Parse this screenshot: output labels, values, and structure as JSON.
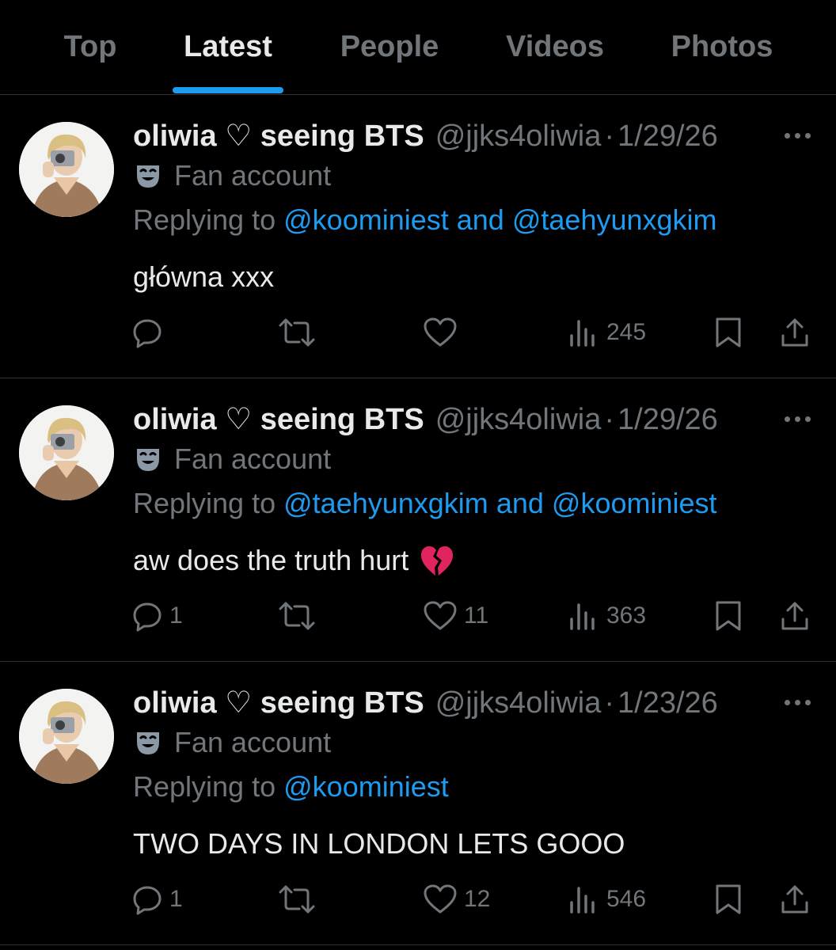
{
  "tabs": [
    {
      "label": "Top",
      "active": false
    },
    {
      "label": "Latest",
      "active": true
    },
    {
      "label": "People",
      "active": false
    },
    {
      "label": "Videos",
      "active": false
    },
    {
      "label": "Photos",
      "active": false
    }
  ],
  "colors": {
    "background": "#000000",
    "text": "#e7e9ea",
    "muted": "#71767b",
    "accent": "#1d9bf0",
    "divider": "#2f3336"
  },
  "tweets": [
    {
      "name": "oliwia ♡ seeing BTS",
      "handle": "@jjks4oliwia",
      "separator": "·",
      "date": "1/29/26",
      "badge_icon": "theater-masks-icon",
      "badge": "Fan account",
      "replying_prefix": "Replying to",
      "mention1": "@koominiest",
      "joiner": "and",
      "mention2": "@taehyunxgkim",
      "text": "główna xxx",
      "emoji": "",
      "reply_count": "",
      "like_count": "",
      "views": "245"
    },
    {
      "name": "oliwia ♡ seeing BTS",
      "handle": "@jjks4oliwia",
      "separator": "·",
      "date": "1/29/26",
      "badge_icon": "theater-masks-icon",
      "badge": "Fan account",
      "replying_prefix": "Replying to",
      "mention1": "@taehyunxgkim",
      "joiner": "and",
      "mention2": "@koominiest",
      "text": "aw does the truth hurt",
      "emoji": "broken-heart-emoji",
      "reply_count": "1",
      "like_count": "11",
      "views": "363"
    },
    {
      "name": "oliwia ♡ seeing BTS",
      "handle": "@jjks4oliwia",
      "separator": "·",
      "date": "1/23/26",
      "badge_icon": "theater-masks-icon",
      "badge": "Fan account",
      "replying_prefix": "Replying to",
      "mention1": "@koominiest",
      "joiner": "",
      "mention2": "",
      "text": "TWO DAYS IN LONDON LETS GOOO",
      "emoji": "",
      "reply_count": "1",
      "like_count": "12",
      "views": "546"
    }
  ],
  "action_icons": [
    "reply-icon",
    "retweet-icon",
    "like-icon",
    "views-icon",
    "bookmark-icon",
    "share-icon"
  ]
}
